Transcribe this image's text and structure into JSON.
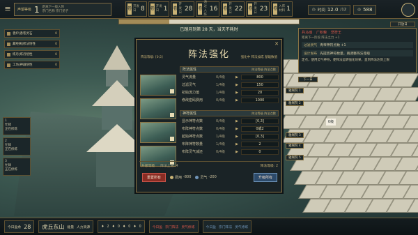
{
  "topbar": {
    "menu_icon": "menu-icon",
    "player_title": "声望等级",
    "player_level": "1",
    "player_sub_1": "距离下一级入阵",
    "player_sub_2": "宗门名称 宗门弟子",
    "slots": [
      {
        "label": "开发日",
        "value": "8"
      },
      {
        "label": "开发日",
        "value": "1"
      },
      {
        "label": "开发日",
        "value": "28"
      },
      {
        "label": "通过入阵",
        "value": "16"
      },
      {
        "label": "开发日",
        "value": "22"
      },
      {
        "label": "开发日",
        "value": "23"
      },
      {
        "label": "入阵材料",
        "value": "1"
      }
    ],
    "time_label": "时间",
    "time_value": "12.0",
    "time_unit": "/12",
    "resource_value": "588",
    "event_button": "开放日"
  },
  "progress": {
    "fraction": 0.28
  },
  "notice": "已踏月到第 28 天，当天不耗时",
  "left_list": [
    {
      "label": "香炉|香客灵石",
      "count": "0"
    },
    {
      "label": "藏经阁|修法悟性",
      "count": "0"
    },
    {
      "label": "炼丹|炼丹悟性",
      "count": "0"
    },
    {
      "label": "工坊|神器悟性",
      "count": "0"
    }
  ],
  "side_cards": [
    {
      "line1": "1",
      "line2": "忙碌",
      "line3": "正在修炼"
    },
    {
      "line1": "2",
      "line2": "忙碌",
      "line3": "正在修炼"
    },
    {
      "line1": "3",
      "line2": "忙碌",
      "line3": "正在修炼"
    }
  ],
  "panel": {
    "title": "阵法强化",
    "level_label": "阵法等级: [0,5]",
    "tab_text": "强化中 阵法加成 基础数值",
    "close_icon": "close-icon",
    "sec1": {
      "title": "阵法属性",
      "hint": "阵法等级 阵法点数"
    },
    "rows1": [
      {
        "name": "灵气流量",
        "points": "0/4级",
        "value": "800"
      },
      {
        "name": "过滤灵气",
        "points": "1/4级",
        "value": "150"
      },
      {
        "name": "初始流力值",
        "points": "1/4级",
        "value": "20"
      },
      {
        "name": "修改密码费用",
        "points": "0/4级",
        "value": "1000"
      }
    ],
    "sec2": {
      "title": "神符属性",
      "hint": "阵法等级 阵法点数"
    },
    "rows2": [
      {
        "name": "显示神符点数",
        "points": "0/4级",
        "value": "[0,3]"
      },
      {
        "name": "布阵神符点数",
        "points": "0/4级",
        "value": "0或2"
      },
      {
        "name": "起始神符点数",
        "points": "1/4级",
        "value": "[0,3]"
      },
      {
        "name": "布阵神符数量",
        "points": "1/4级",
        "value": "2"
      },
      {
        "name": "布阵灵气减还",
        "points": "0/4级",
        "value": "0"
      }
    ],
    "foot_left": "升级等级",
    "foot_mid": "阵法上限: 4",
    "foot_right": "阵法等级: 2",
    "reset_button": "重置所有",
    "cost1_label": "费用",
    "cost1_value": "-800",
    "cost2_label": "灵气",
    "cost2_value": "-200",
    "confirm_button": "升级所有"
  },
  "right_panel": {
    "name": "兵马魂",
    "tag": "广积粮",
    "tag2": "悲符王",
    "sub": "距离下一阶段 阵法之力 +1",
    "line1_key": "过滤灵气",
    "line1_val": "青帝神符点数 +1",
    "line2_key": "设计发布",
    "line2_val": "先提高神符数量，再调整阵法等级",
    "desc": "定点，使用灵气神符，使阵法运转强化效果，直到阵法达到上限"
  },
  "next_button": "下一日",
  "map_tags": [
    "雅阁院 1",
    "雅阁院 2",
    "雅阁院 3",
    "雅阁院 4",
    "雅阁院 5"
  ],
  "map_marker": "0级",
  "bottom": {
    "day_label": "今日盈余",
    "day_value": "28",
    "location": "虎丘东山",
    "sub1": "能量",
    "sub2": "人力资源",
    "c1": "2",
    "c2": "0",
    "c3": "0",
    "c4": "0",
    "msg1_a": "今日盈",
    "msg1_b": "宗门阵法",
    "msg1_c": "灵气修炼",
    "msg2_a": "今日盈",
    "msg2_b": "宗门阵法",
    "msg2_c": "灵气修炼"
  }
}
